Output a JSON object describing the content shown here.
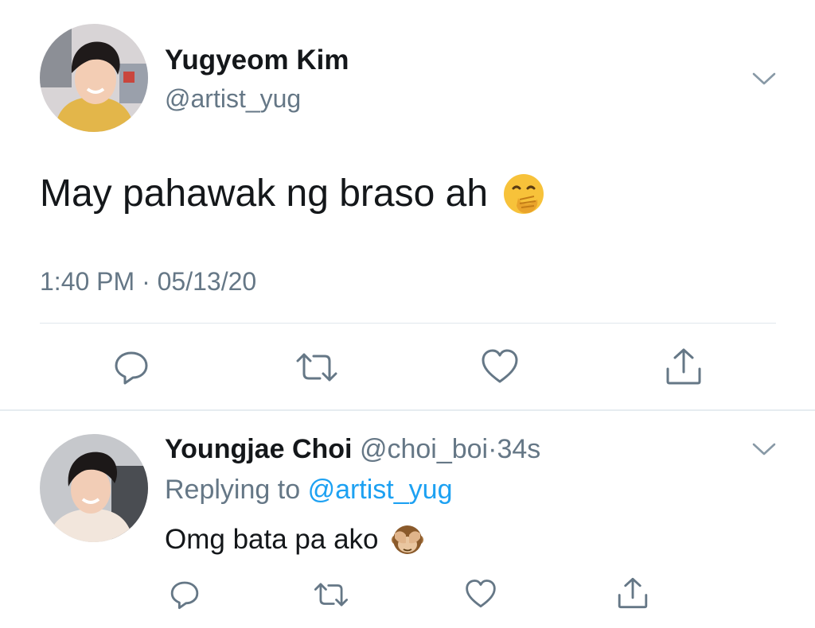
{
  "colors": {
    "text": "#14171a",
    "muted": "#657786",
    "link": "#1da1f2",
    "divider": "#e1e8ed",
    "icon": "#657786"
  },
  "main_tweet": {
    "author_name": "Yugyeom Kim",
    "author_handle": "@artist_yug",
    "text": "May pahawak ng braso ah",
    "text_emoji": "face-with-hand-over-mouth-emoji",
    "time": "1:40 PM",
    "separator": "·",
    "date": "05/13/20",
    "actions": [
      "reply-icon",
      "retweet-icon",
      "like-icon",
      "share-icon"
    ]
  },
  "reply_tweet": {
    "author_name": "Youngjae Choi",
    "author_handle": "@choi_boi",
    "separator": "·",
    "age": "34s",
    "replying_prefix": "Replying to",
    "replying_handle": "@artist_yug",
    "text": "Omg bata pa ako",
    "text_emoji": "see-no-evil-monkey-emoji",
    "actions": [
      "reply-icon",
      "retweet-icon",
      "like-icon",
      "share-icon"
    ]
  }
}
